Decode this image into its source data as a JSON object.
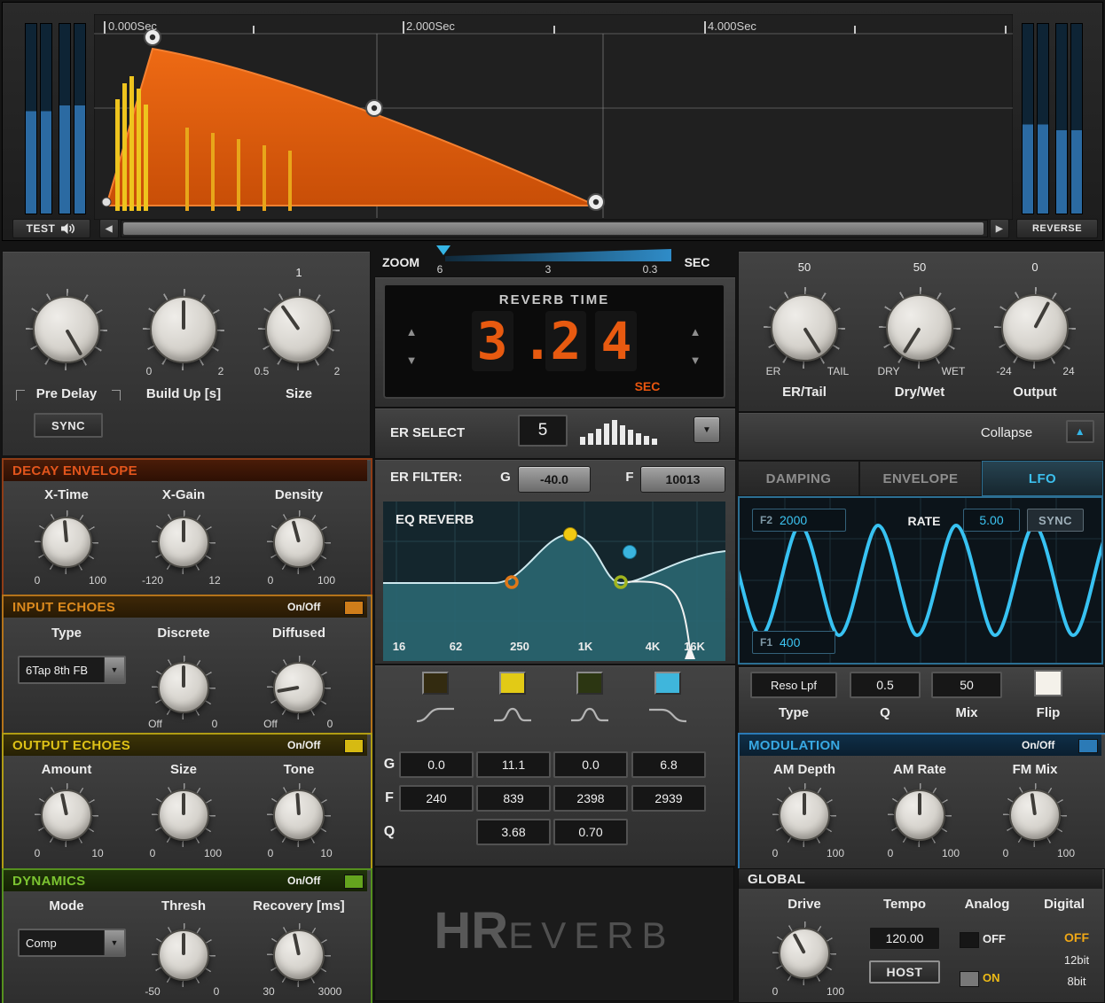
{
  "icons": {
    "up_arrow": "▲",
    "down_arrow": "▼",
    "left_arrow": "◀",
    "right_arrow": "▶"
  },
  "top_display": {
    "ruler_labels": [
      "0.000Sec",
      "2.000Sec",
      "4.000Sec"
    ],
    "test_button": "TEST",
    "reverse_button": "REVERSE"
  },
  "zoom_bar": {
    "label": "ZOOM",
    "ticks": [
      "6",
      "3",
      "0.3"
    ],
    "unit": "SEC"
  },
  "main_left": {
    "pre_delay": {
      "label": "Pre Delay",
      "sync_button": "SYNC"
    },
    "build_up": {
      "label": "Build Up [s]",
      "min": "0",
      "max": "2"
    },
    "size": {
      "label": "Size",
      "min": "0.5",
      "max": "2",
      "value": "1"
    }
  },
  "decay_envelope": {
    "title": "DECAY ENVELOPE",
    "x_time": {
      "label": "X-Time",
      "min": "0",
      "max": "100"
    },
    "x_gain": {
      "label": "X-Gain",
      "min": "-120",
      "max": "12"
    },
    "density": {
      "label": "Density",
      "min": "0",
      "max": "100"
    }
  },
  "input_echoes": {
    "title": "INPUT ECHOES",
    "on_off": "On/Off",
    "type": {
      "label": "Type",
      "value": "6Tap 8th FB"
    },
    "discrete": {
      "label": "Discrete",
      "min": "Off",
      "max": "0"
    },
    "diffused": {
      "label": "Diffused",
      "min": "Off",
      "max": "0"
    }
  },
  "output_echoes": {
    "title": "OUTPUT ECHOES",
    "on_off": "On/Off",
    "amount": {
      "label": "Amount",
      "min": "0",
      "max": "10"
    },
    "size": {
      "label": "Size",
      "min": "0",
      "max": "100"
    },
    "tone": {
      "label": "Tone",
      "min": "0",
      "max": "10"
    }
  },
  "dynamics": {
    "title": "DYNAMICS",
    "on_off": "On/Off",
    "mode": {
      "label": "Mode",
      "value": "Comp"
    },
    "thresh": {
      "label": "Thresh",
      "min": "-50",
      "max": "0"
    },
    "recovery": {
      "label": "Recovery [ms]",
      "min": "30",
      "max": "3000"
    }
  },
  "reverb_time": {
    "title": "REVERB TIME",
    "digits": [
      "3",
      ".",
      "2",
      "4"
    ],
    "value": "3.24",
    "unit": "SEC"
  },
  "er_select": {
    "label": "ER SELECT",
    "value": "5"
  },
  "er_filter": {
    "label": "ER FILTER:",
    "g_label": "G",
    "g_value": "-40.0",
    "f_label": "F",
    "f_value": "10013"
  },
  "eq": {
    "title": "EQ REVERB",
    "freq_labels": [
      "16",
      "62",
      "250",
      "1K",
      "4K",
      "16K"
    ],
    "row_labels": [
      "G",
      "F",
      "Q"
    ],
    "g_values": [
      "0.0",
      "11.1",
      "0.0",
      "6.8"
    ],
    "f_values": [
      "240",
      "839",
      "2398",
      "2939"
    ],
    "q_values": [
      "3.68",
      "0.70"
    ],
    "band_colors": [
      "#332b10",
      "#e2ca16",
      "#2c3612",
      "#3fb6dc"
    ]
  },
  "logo": {
    "h": "H",
    "r": "R",
    "rest": "EVERB"
  },
  "main_right": {
    "er_tail": {
      "label": "ER/Tail",
      "value": "50",
      "min": "ER",
      "max": "TAIL"
    },
    "dry_wet": {
      "label": "Dry/Wet",
      "value": "50",
      "min": "DRY",
      "max": "WET"
    },
    "output": {
      "label": "Output",
      "value": "0",
      "min": "-24",
      "max": "24"
    },
    "collapse": "Collapse"
  },
  "tabs": {
    "damping": "DAMPING",
    "envelope": "ENVELOPE",
    "lfo": "LFO"
  },
  "lfo": {
    "f2_label": "F2",
    "f2_value": "2000",
    "rate_label": "RATE",
    "rate_value": "5.00",
    "sync_button": "SYNC",
    "f1_label": "F1",
    "f1_value": "400",
    "type": {
      "label": "Type",
      "value": "Reso Lpf"
    },
    "q": {
      "label": "Q",
      "value": "0.5"
    },
    "mix": {
      "label": "Mix",
      "value": "50"
    },
    "flip": {
      "label": "Flip"
    }
  },
  "modulation": {
    "title": "MODULATION",
    "on_off": "On/Off",
    "am_depth": {
      "label": "AM Depth",
      "min": "0",
      "max": "100"
    },
    "am_rate": {
      "label": "AM Rate",
      "min": "0",
      "max": "100"
    },
    "fm_mix": {
      "label": "FM Mix",
      "min": "0",
      "max": "100"
    }
  },
  "global": {
    "title": "GLOBAL",
    "drive": {
      "label": "Drive",
      "min": "0",
      "max": "100"
    },
    "tempo": {
      "label": "Tempo",
      "value": "120.00",
      "host_button": "HOST"
    },
    "analog": {
      "label": "Analog",
      "off": "OFF",
      "on": "ON"
    },
    "digital": {
      "label": "Digital",
      "options": [
        "OFF",
        "12bit",
        "8bit"
      ]
    }
  }
}
